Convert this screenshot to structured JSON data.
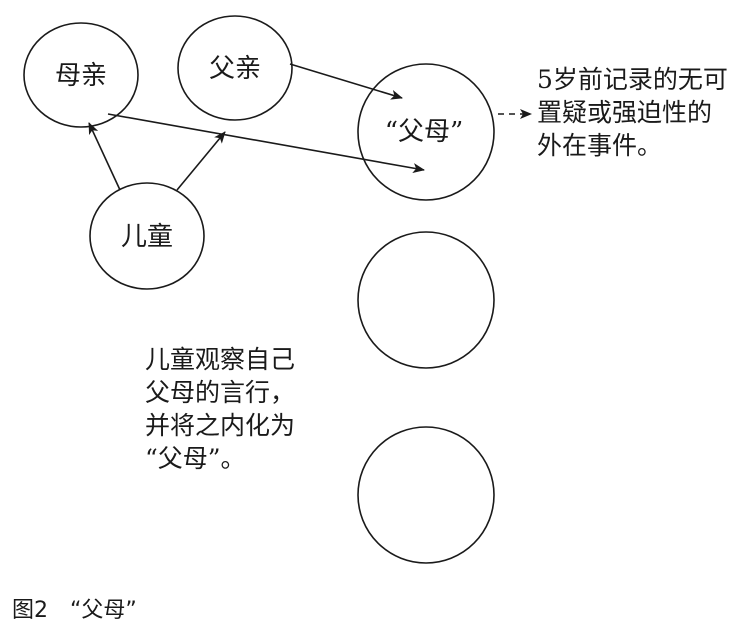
{
  "nodes": {
    "mother": "母亲",
    "father": "父亲",
    "parents": "“父母”",
    "child": "儿童"
  },
  "side_note": {
    "lines": [
      "5岁前记录的无可",
      "置疑或强迫性的",
      "外在事件。"
    ]
  },
  "center_note": {
    "lines": [
      "儿童观察自己",
      "父母的言行，",
      "并将之内化为",
      "“父母”。"
    ]
  },
  "caption": "图2　“父母”",
  "colors": {
    "stroke": "#1a1a1a",
    "background": "#ffffff"
  }
}
